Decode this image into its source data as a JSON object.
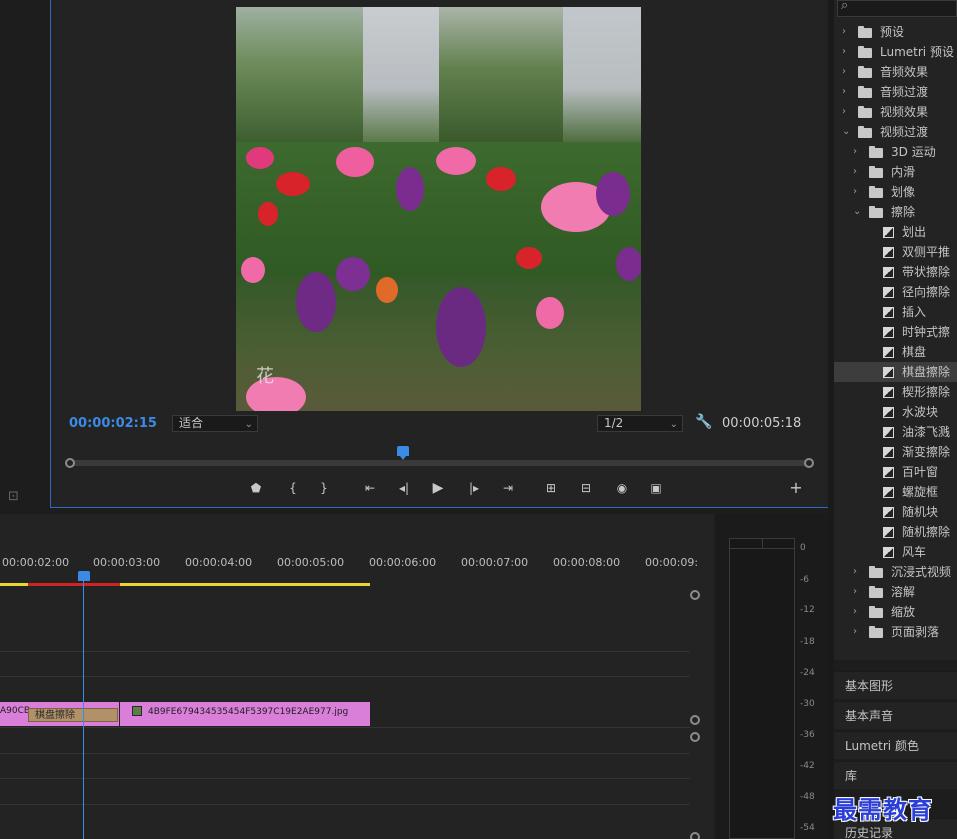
{
  "monitor": {
    "timecode_current": "00:00:02:15",
    "timecode_duration": "00:00:05:18",
    "fit_select": "适合",
    "resolution_select": "1/2",
    "video_watermark": "花"
  },
  "timeline": {
    "ticks": [
      "00:00:02:00",
      "00:00:03:00",
      "00:00:04:00",
      "00:00:05:00",
      "00:00:06:00",
      "00:00:07:00",
      "00:00:08:00",
      "00:00:09:"
    ],
    "clip_a_label": "A90CB",
    "transition_label": "棋盘擦除",
    "clip_b_label": "4B9FE679434535454F5397C19E2AE977.jpg"
  },
  "meter": {
    "db_labels": [
      "0",
      "-6",
      "-12",
      "-18",
      "-24",
      "-30",
      "-36",
      "-42",
      "-48",
      "-54"
    ]
  },
  "effects": {
    "tree": [
      {
        "label": "预设",
        "kind": "bin",
        "depth": 0,
        "expanded": false
      },
      {
        "label": "Lumetri 预设",
        "kind": "bin",
        "depth": 0,
        "expanded": false
      },
      {
        "label": "音频效果",
        "kind": "folder",
        "depth": 0,
        "expanded": false
      },
      {
        "label": "音频过渡",
        "kind": "folder",
        "depth": 0,
        "expanded": false
      },
      {
        "label": "视频效果",
        "kind": "folder",
        "depth": 0,
        "expanded": false
      },
      {
        "label": "视频过渡",
        "kind": "folder",
        "depth": 0,
        "expanded": true
      },
      {
        "label": "3D 运动",
        "kind": "folder",
        "depth": 1,
        "expanded": false
      },
      {
        "label": "内滑",
        "kind": "folder",
        "depth": 1,
        "expanded": false
      },
      {
        "label": "划像",
        "kind": "folder",
        "depth": 1,
        "expanded": false
      },
      {
        "label": "擦除",
        "kind": "folder",
        "depth": 1,
        "expanded": true
      },
      {
        "label": "划出",
        "kind": "fx",
        "depth": 2
      },
      {
        "label": "双侧平推",
        "kind": "fx",
        "depth": 2
      },
      {
        "label": "带状擦除",
        "kind": "fx",
        "depth": 2
      },
      {
        "label": "径向擦除",
        "kind": "fx",
        "depth": 2
      },
      {
        "label": "插入",
        "kind": "fx",
        "depth": 2
      },
      {
        "label": "时钟式擦",
        "kind": "fx",
        "depth": 2
      },
      {
        "label": "棋盘",
        "kind": "fx",
        "depth": 2
      },
      {
        "label": "棋盘擦除",
        "kind": "fx",
        "depth": 2,
        "selected": true
      },
      {
        "label": "楔形擦除",
        "kind": "fx",
        "depth": 2
      },
      {
        "label": "水波块",
        "kind": "fx",
        "depth": 2
      },
      {
        "label": "油漆飞溅",
        "kind": "fx",
        "depth": 2
      },
      {
        "label": "渐变擦除",
        "kind": "fx",
        "depth": 2
      },
      {
        "label": "百叶窗",
        "kind": "fx",
        "depth": 2
      },
      {
        "label": "螺旋框",
        "kind": "fx",
        "depth": 2
      },
      {
        "label": "随机块",
        "kind": "fx",
        "depth": 2
      },
      {
        "label": "随机擦除",
        "kind": "fx",
        "depth": 2
      },
      {
        "label": "风车",
        "kind": "fx",
        "depth": 2
      },
      {
        "label": "沉浸式视频",
        "kind": "folder",
        "depth": 1,
        "expanded": false
      },
      {
        "label": "溶解",
        "kind": "folder",
        "depth": 1,
        "expanded": false
      },
      {
        "label": "缩放",
        "kind": "folder",
        "depth": 1,
        "expanded": false
      },
      {
        "label": "页面剥落",
        "kind": "folder",
        "depth": 1,
        "expanded": false
      }
    ]
  },
  "panels": {
    "essential_graphics": "基本图形",
    "essential_sound": "基本声音",
    "lumetri_color": "Lumetri 颜色",
    "libraries": "库",
    "history": "历史记录"
  },
  "watermark": "最需教育",
  "colors": {
    "accent_blue": "#3b8be6",
    "clip_pink": "#d97ed9",
    "transition_tan": "#b0916a",
    "work_area_yellow": "#e6d62f"
  }
}
